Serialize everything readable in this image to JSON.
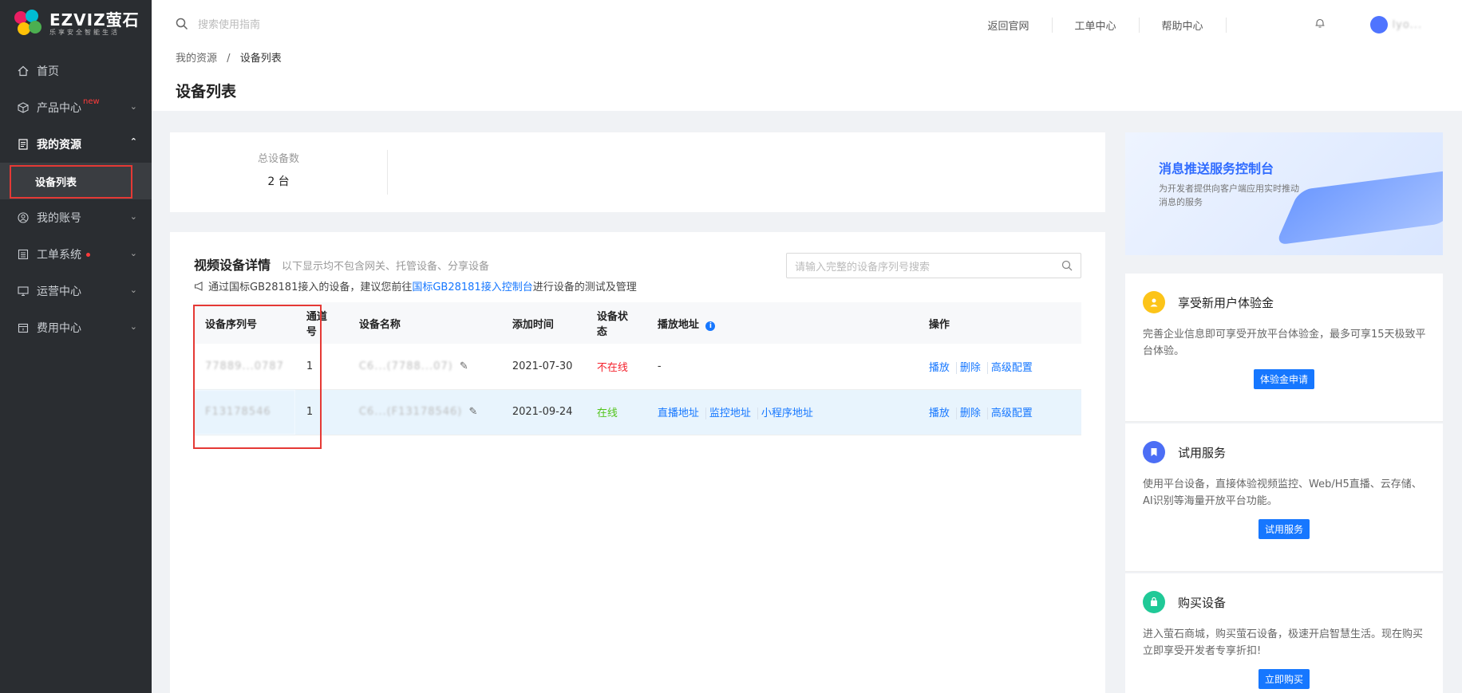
{
  "brand": {
    "name": "EZVIZ萤石",
    "tagline": "乐享安全智能生活"
  },
  "sidebar": {
    "items": [
      {
        "label": "首页",
        "icon": "home-icon"
      },
      {
        "label": "产品中心",
        "badge": "new",
        "icon": "cube-icon"
      },
      {
        "label": "我的资源",
        "icon": "document-icon",
        "active": true,
        "sub": [
          {
            "label": "设备列表",
            "active": true
          }
        ]
      },
      {
        "label": "我的账号",
        "icon": "user-icon"
      },
      {
        "label": "工单系统",
        "icon": "list-icon",
        "dot": true
      },
      {
        "label": "运营中心",
        "icon": "monitor-icon"
      },
      {
        "label": "费用中心",
        "icon": "wallet-icon"
      }
    ]
  },
  "header": {
    "search_placeholder": "搜索使用指南",
    "nav": [
      "返回官网",
      "工单中心",
      "帮助中心"
    ],
    "user_name": "lyo...",
    "breadcrumb": [
      "我的资源",
      "设备列表"
    ],
    "breadcrumb_sep": "/",
    "title": "设备列表"
  },
  "summary": {
    "label": "总设备数",
    "value": "2 台"
  },
  "details": {
    "title": "视频设备详情",
    "subtitle": "以下显示均不包含网关、托管设备、分享设备",
    "notice_prefix": "通过国标GB28181接入的设备，建议您前往",
    "notice_link": "国标GB28181接入控制台",
    "notice_suffix": "进行设备的测试及管理",
    "search_placeholder": "请输入完整的设备序列号搜索",
    "columns": [
      "设备序列号",
      "通道号",
      "设备名称",
      "添加时间",
      "设备状态",
      "播放地址",
      "操作"
    ],
    "rows": [
      {
        "serial": "77889...0787",
        "channel": "1",
        "name": "C6...(7788...07)",
        "time": "2021-07-30",
        "status": "不在线",
        "status_color": "#f5222d",
        "play": "-",
        "play_links": [],
        "ops": [
          "播放",
          "删除",
          "高级配置"
        ]
      },
      {
        "serial": "F13178546",
        "channel": "1",
        "name": "C6...(F13178546)",
        "time": "2021-09-24",
        "status": "在线",
        "status_color": "#52c41a",
        "play": "",
        "play_links": [
          "直播地址",
          "监控地址",
          "小程序地址"
        ],
        "ops": [
          "播放",
          "删除",
          "高级配置"
        ]
      }
    ]
  },
  "banner": {
    "title": "消息推送服务控制台",
    "desc": "为开发者提供向客户端应用实时推动消息的服务"
  },
  "cards": [
    {
      "title": "享受新用户体验金",
      "desc": "完善企业信息即可享受开放平台体验金，最多可享15天极致平台体验。",
      "button": "体验金申请",
      "icon_color": "#fcc419",
      "icon": "user-icon"
    },
    {
      "title": "试用服务",
      "desc": "使用平台设备，直接体验视频监控、Web/H5直播、云存储、AI识别等海量开放平台功能。",
      "button": "试用服务",
      "icon_color": "#4c6ef5",
      "icon": "bookmark-icon"
    },
    {
      "title": "购买设备",
      "desc": "进入萤石商城，购买萤石设备，极速开启智慧生活。现在购买立即享受开发者专享折扣!",
      "button": "立即购买",
      "icon_color": "#20c997",
      "icon": "shopping-bag-icon"
    }
  ]
}
